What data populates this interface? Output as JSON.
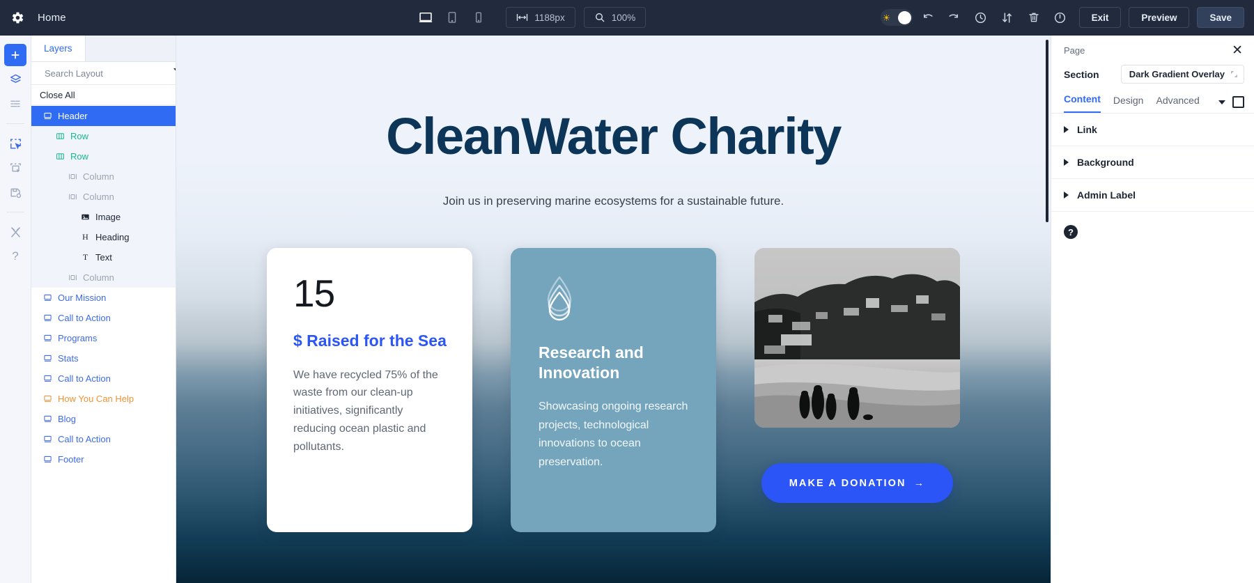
{
  "topbar": {
    "gear_icon": "gear-icon",
    "home_label": "Home",
    "devices": [
      {
        "name": "desktop",
        "icon": "desktop-icon",
        "active": true
      },
      {
        "name": "tablet",
        "icon": "tablet-icon",
        "active": false
      },
      {
        "name": "phone",
        "icon": "phone-icon",
        "active": false
      }
    ],
    "width_value": "1188px",
    "zoom_value": "100%",
    "actions": [
      {
        "name": "undo",
        "icon": "undo-icon"
      },
      {
        "name": "redo",
        "icon": "redo-icon"
      },
      {
        "name": "history",
        "icon": "clock-icon"
      },
      {
        "name": "portability",
        "icon": "updown-arrows-icon"
      },
      {
        "name": "trash",
        "icon": "trash-icon"
      },
      {
        "name": "power",
        "icon": "power-icon"
      }
    ],
    "exit_label": "Exit",
    "preview_label": "Preview",
    "save_label": "Save",
    "theme_icon": "sun-icon"
  },
  "rail": {
    "items": [
      {
        "name": "add",
        "icon": "plus-icon",
        "active": true
      },
      {
        "name": "layers",
        "icon": "layers-icon",
        "active": false
      },
      {
        "name": "wireframe",
        "icon": "wireframe-icon",
        "active": false
      },
      {
        "name": "select",
        "icon": "select-module-icon",
        "active": false
      },
      {
        "name": "duplicate",
        "icon": "copy-module-icon",
        "active": false
      },
      {
        "name": "save-library",
        "icon": "save-library-icon",
        "active": false
      },
      {
        "name": "tools",
        "icon": "wrench-icon",
        "active": false
      },
      {
        "name": "help",
        "icon": "question-mark-icon",
        "active": false
      }
    ]
  },
  "layers": {
    "tab_label": "Layers",
    "search_placeholder": "Search Layout",
    "search_value": "",
    "filter_icon": "filter-icon",
    "close_all_label": "Close All",
    "tree": [
      {
        "label": "Header",
        "type": "section",
        "indent": 0,
        "color": "selected",
        "icon": "section-icon"
      },
      {
        "label": "Row",
        "type": "row",
        "indent": 1,
        "color": "green",
        "icon": "row-icon"
      },
      {
        "label": "Row",
        "type": "row",
        "indent": 1,
        "color": "green",
        "icon": "row-icon"
      },
      {
        "label": "Column",
        "type": "column",
        "indent": 2,
        "color": "gray",
        "icon": "column-icon"
      },
      {
        "label": "Column",
        "type": "column",
        "indent": 2,
        "color": "gray",
        "icon": "column-icon"
      },
      {
        "label": "Image",
        "type": "module",
        "indent": 3,
        "color": "dark",
        "icon": "image-icon"
      },
      {
        "label": "Heading",
        "type": "module",
        "indent": 3,
        "color": "dark",
        "icon": "heading-icon"
      },
      {
        "label": "Text",
        "type": "module",
        "indent": 3,
        "color": "dark",
        "icon": "text-icon"
      },
      {
        "label": "Column",
        "type": "column",
        "indent": 2,
        "color": "gray",
        "icon": "column-icon"
      },
      {
        "label": "Our Mission",
        "type": "section",
        "indent": 0,
        "color": "blue",
        "icon": "section-icon"
      },
      {
        "label": "Call to Action",
        "type": "section",
        "indent": 0,
        "color": "blue",
        "icon": "section-icon"
      },
      {
        "label": "Programs",
        "type": "section",
        "indent": 0,
        "color": "blue",
        "icon": "section-icon"
      },
      {
        "label": "Stats",
        "type": "section",
        "indent": 0,
        "color": "blue",
        "icon": "section-icon"
      },
      {
        "label": "Call to Action",
        "type": "section",
        "indent": 0,
        "color": "blue",
        "icon": "section-icon"
      },
      {
        "label": "How You Can Help",
        "type": "section",
        "indent": 0,
        "color": "orange",
        "icon": "section-icon"
      },
      {
        "label": "Blog",
        "type": "section",
        "indent": 0,
        "color": "blue",
        "icon": "section-icon"
      },
      {
        "label": "Call to Action",
        "type": "section",
        "indent": 0,
        "color": "blue",
        "icon": "section-icon"
      },
      {
        "label": "Footer",
        "type": "section",
        "indent": 0,
        "color": "blue",
        "icon": "section-icon"
      }
    ]
  },
  "canvas": {
    "hero_title": "CleanWater Charity",
    "hero_subtitle": "Join us in preserving marine ecosystems for a sustainable future.",
    "card1": {
      "number": "15",
      "heading": "$ Raised for the Sea",
      "body": "We have recycled 75% of the waste from our clean-up initiatives, significantly reducing ocean plastic and pollutants."
    },
    "card2": {
      "icon": "water-drop-icon",
      "heading": "Research and Innovation",
      "body": "Showcasing ongoing research projects, technological innovations to ocean preservation."
    },
    "card3": {
      "image_alt": "beach-photo",
      "button_label": "MAKE A DONATION",
      "button_arrow": "→"
    },
    "colors": {
      "title": "#0c3557",
      "accent_blue": "#2b55f7",
      "card2_bg": "#74a5bd",
      "card1_bg": "#ffffff"
    }
  },
  "right_panel": {
    "breadcrumb": "Page",
    "close_icon": "close-icon",
    "section_label": "Section",
    "section_value": "Dark Gradient Overlay",
    "tabs": [
      {
        "label": "Content",
        "active": true
      },
      {
        "label": "Design",
        "active": false
      },
      {
        "label": "Advanced",
        "active": false
      }
    ],
    "accordions": [
      {
        "label": "Link"
      },
      {
        "label": "Background"
      },
      {
        "label": "Admin Label"
      }
    ],
    "help_label": "?"
  }
}
